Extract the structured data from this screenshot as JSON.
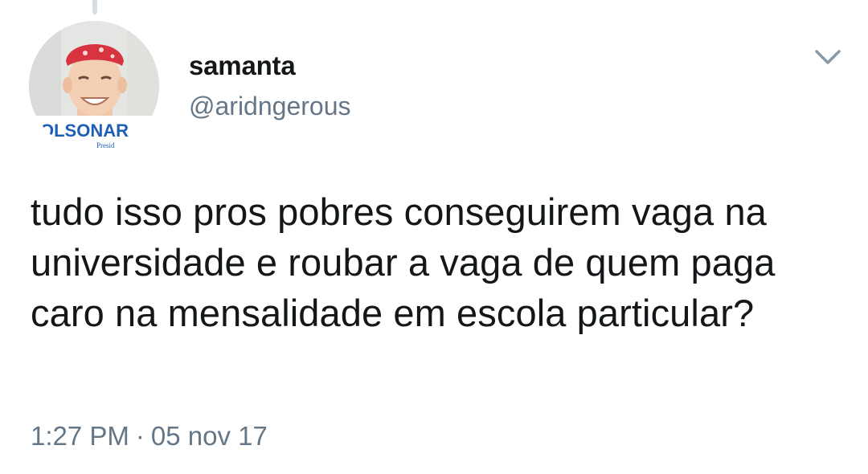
{
  "tweet": {
    "display_name": "samanta",
    "handle": "@aridngerous",
    "text": "tudo isso pros pobres conseguirem vaga na universidade e roubar a vaga de quem paga caro na mensalidade em escola particular?",
    "time": "1:27 PM",
    "separator": "·",
    "date": "05 nov 17"
  },
  "avatar": {
    "banner_text": "OLSONAR",
    "banner_subtext": "Presid"
  },
  "icons": {
    "menu": "chevron-down-icon"
  },
  "colors": {
    "text_primary": "#14171a",
    "text_secondary": "#657786",
    "banner_blue": "#1f5fb3",
    "bandana_red": "#d8343f"
  }
}
